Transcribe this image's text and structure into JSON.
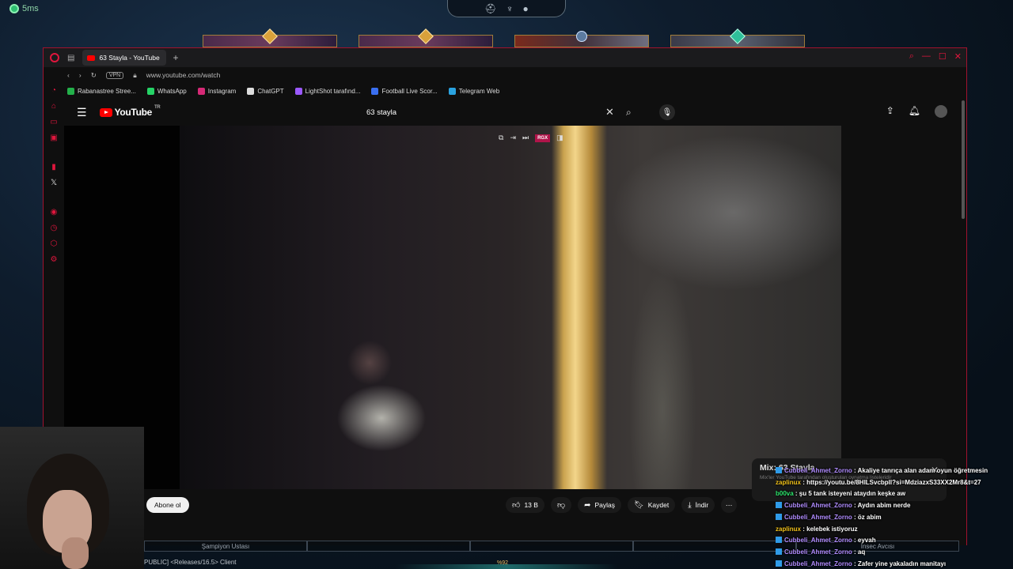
{
  "game": {
    "ping": "5ms",
    "client_label": "PUBLIC] <Releases/16.5> Client",
    "bottom_percent": "%92",
    "hud_labels": [
      "Şampiyon Ustası",
      "",
      "",
      "",
      "İnsec Avcısı"
    ]
  },
  "browser": {
    "tab_title": "63 Stayla - YouTube",
    "vpn": "VPN",
    "url": "www.youtube.com/watch",
    "bookmarks": [
      {
        "label": "Rabanastree Stree...",
        "color": "#23b04a"
      },
      {
        "label": "WhatsApp",
        "color": "#25d366"
      },
      {
        "label": "Instagram",
        "color": "#d62976"
      },
      {
        "label": "ChatGPT",
        "color": "#dddddd"
      },
      {
        "label": "LightShot tarafınd...",
        "color": "#9b59ff"
      },
      {
        "label": "Football Live Scor...",
        "color": "#3a6ff0"
      },
      {
        "label": "Telegram Web",
        "color": "#2aa3e0"
      }
    ]
  },
  "youtube": {
    "logo_text": "YouTube",
    "region": "TR",
    "search_value": "63 stayla",
    "video_tools_badge": "RGX",
    "subscribe_label": "Abone ol",
    "like_count": "13 B",
    "share_label": "Paylaş",
    "save_label": "Kaydet",
    "download_label": "İndir",
    "mix_title": "Mix: 63 Stayla",
    "mix_subtitle": "Mix'ler YouTube tarafından oluşturulan oynatma listeleridir"
  },
  "chat": [
    {
      "user": "Cubbeli_Ahmet_Zorno",
      "color": "purple",
      "badge": true,
      "text": "Akaliye tanrıça alan adam oyun öğretmesin"
    },
    {
      "user": "zaplinux",
      "color": "yellow",
      "badge": false,
      "text": "https://youtu.be/8HlLSvcbpll?si=MdziazxS33XX2Mr8&t=27"
    },
    {
      "user": "b00va",
      "color": "green",
      "badge": false,
      "text": "şu 5 tank isteyeni ataydın keşke aw"
    },
    {
      "user": "Cubbeli_Ahmet_Zorno",
      "color": "purple",
      "badge": true,
      "text": "Aydın abim nerde"
    },
    {
      "user": "Cubbeli_Ahmet_Zorno",
      "color": "purple",
      "badge": true,
      "text": "öz abim"
    },
    {
      "user": "zaplinux",
      "color": "yellow",
      "badge": false,
      "text": "kelebek istiyoruz"
    },
    {
      "user": "Cubbeli_Ahmet_Zorno",
      "color": "purple",
      "badge": true,
      "text": "eyvah"
    },
    {
      "user": "Cubbeli_Ahmet_Zorno",
      "color": "purple",
      "badge": true,
      "text": "aq"
    },
    {
      "user": "Cubbeli_Ahmet_Zorno",
      "color": "purple",
      "badge": true,
      "text": "Zafer yine yakaladın manitayı"
    }
  ]
}
